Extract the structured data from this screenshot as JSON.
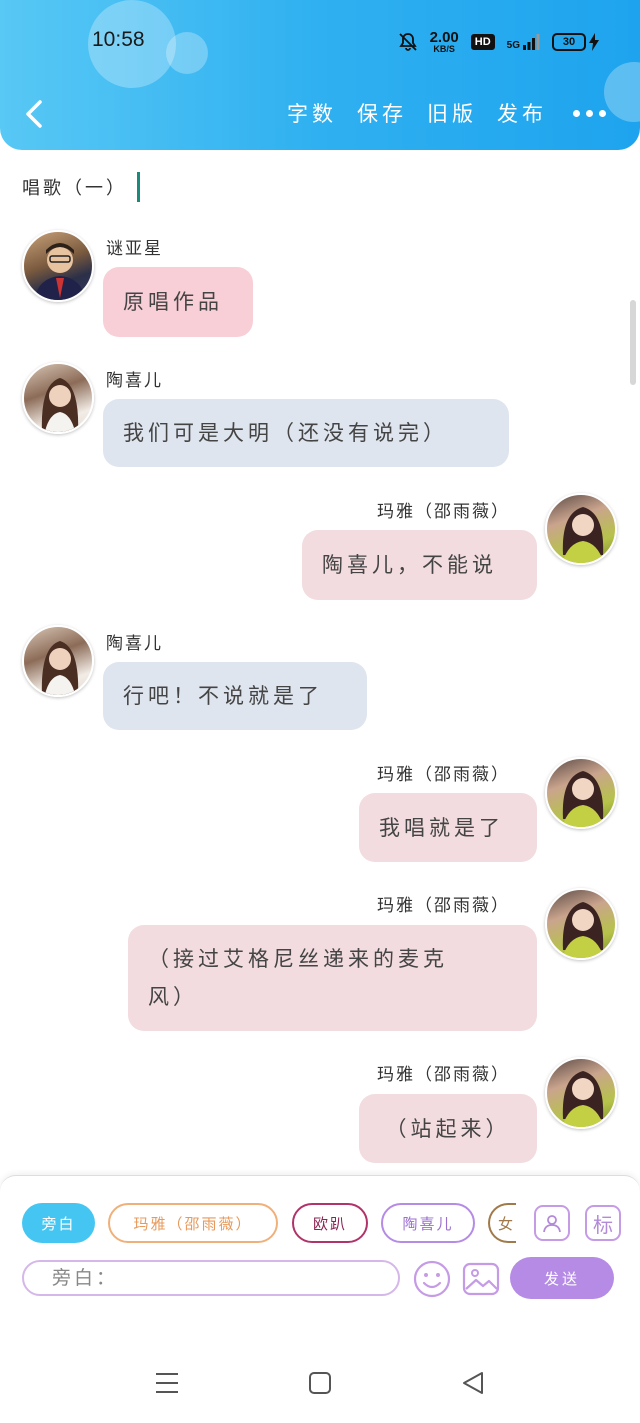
{
  "status_bar": {
    "time": "10:58",
    "net_speed": "2.00",
    "net_unit": "KB/S",
    "hd": "HD",
    "network": "5G",
    "battery": "30"
  },
  "toolbar": {
    "word_count": "字数",
    "save": "保存",
    "old_version": "旧版",
    "publish": "发布"
  },
  "document": {
    "title": "唱歌（一）"
  },
  "messages": [
    {
      "name": "谜亚星",
      "text": "原唱作品"
    },
    {
      "name": "陶喜儿",
      "text": "我们可是大明（还没有说完）"
    },
    {
      "name": "玛雅（邵雨薇）",
      "text": "陶喜儿，不能说"
    },
    {
      "name": "陶喜儿",
      "text": "行吧！不说就是了"
    },
    {
      "name": "玛雅（邵雨薇）",
      "text": "我唱就是了"
    },
    {
      "name": "玛雅（邵雨薇）",
      "text_line1": "（接过艾格尼丝递来的麦克",
      "text_line2": "风）"
    },
    {
      "name": "玛雅（邵雨薇）",
      "text": "（站起来）"
    }
  ],
  "input_panel": {
    "roles": [
      "旁白",
      "玛雅（邵雨薇）",
      "欧趴",
      "陶喜儿",
      "女"
    ],
    "tag_label": "标",
    "input_placeholder": "旁白：",
    "send_label": "发送"
  },
  "colors": {
    "header_gradient": [
      "#58c8f5",
      "#1ea4ee"
    ],
    "send_button": "#b58be6",
    "role_active": "#45c6f2"
  }
}
